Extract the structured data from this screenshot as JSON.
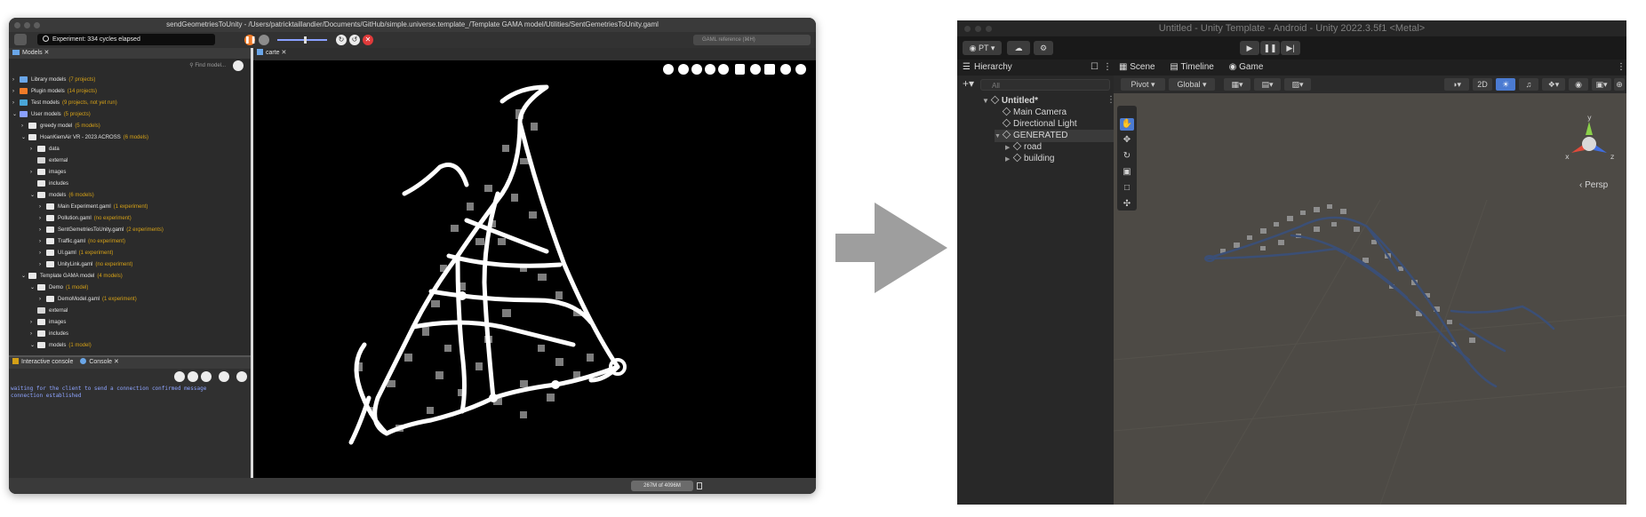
{
  "gama": {
    "title": "sendGeometriesToUnity - /Users/patricktaillandier/Documents/GitHub/simple.universe.template_/Template GAMA model/Utilities/SentGemetriesToUnity.gaml",
    "experiment_label": "Experiment: 334 cycles elapsed",
    "search_placeholder": "GAML reference (⌘H)",
    "models_tab": "Models",
    "find_placeholder": "Find model...",
    "tree": [
      {
        "label": "Library models",
        "note": "(7 projects)",
        "indent": 0,
        "caret": "›",
        "icon": "library"
      },
      {
        "label": "Plugin models",
        "note": "(14 projects)",
        "indent": 0,
        "caret": "›",
        "icon": "plugin"
      },
      {
        "label": "Test models",
        "note": "(9 projects, not yet run)",
        "indent": 0,
        "caret": "›",
        "icon": "test"
      },
      {
        "label": "User models",
        "note": "(5 projects)",
        "indent": 0,
        "caret": "⌄",
        "icon": "user"
      },
      {
        "label": "greedy model",
        "note": "(5 models)",
        "indent": 1,
        "caret": "›",
        "icon": "project"
      },
      {
        "label": "HoanKiemAir VR - 2023 ACROSS",
        "note": "(6 models)",
        "indent": 1,
        "caret": "⌄",
        "icon": "project"
      },
      {
        "label": "data",
        "note": "",
        "indent": 2,
        "caret": "›",
        "icon": "folder"
      },
      {
        "label": "external",
        "note": "",
        "indent": 2,
        "caret": "",
        "icon": "cloud"
      },
      {
        "label": "images",
        "note": "",
        "indent": 2,
        "caret": "›",
        "icon": "folder"
      },
      {
        "label": "includes",
        "note": "",
        "indent": 2,
        "caret": "",
        "icon": "folder"
      },
      {
        "label": "models",
        "note": "(6 models)",
        "indent": 2,
        "caret": "⌄",
        "icon": "folder"
      },
      {
        "label": "Main Experiment.gaml",
        "note": "(1 experiment)",
        "indent": 3,
        "caret": "›",
        "icon": "file"
      },
      {
        "label": "Pollution.gaml",
        "note": "(no experiment)",
        "indent": 3,
        "caret": "›",
        "icon": "file"
      },
      {
        "label": "SentGemetriesToUnity.gaml",
        "note": "(2 experiments)",
        "indent": 3,
        "caret": "›",
        "icon": "file"
      },
      {
        "label": "Traffic.gaml",
        "note": "(no experiment)",
        "indent": 3,
        "caret": "›",
        "icon": "file"
      },
      {
        "label": "UI.gaml",
        "note": "(1 experiment)",
        "indent": 3,
        "caret": "›",
        "icon": "file"
      },
      {
        "label": "UnityLink.gaml",
        "note": "(no experiment)",
        "indent": 3,
        "caret": "›",
        "icon": "file"
      },
      {
        "label": "Template GAMA model",
        "note": "(4 models)",
        "indent": 1,
        "caret": "⌄",
        "icon": "project"
      },
      {
        "label": "Demo",
        "note": "(1 model)",
        "indent": 2,
        "caret": "⌄",
        "icon": "folder"
      },
      {
        "label": "DemoModel.gaml",
        "note": "(1 experiment)",
        "indent": 3,
        "caret": "›",
        "icon": "file"
      },
      {
        "label": "external",
        "note": "",
        "indent": 2,
        "caret": "",
        "icon": "cloud"
      },
      {
        "label": "images",
        "note": "",
        "indent": 2,
        "caret": "›",
        "icon": "folder"
      },
      {
        "label": "includes",
        "note": "",
        "indent": 2,
        "caret": "›",
        "icon": "folder"
      },
      {
        "label": "models",
        "note": "(1 model)",
        "indent": 2,
        "caret": "⌄",
        "icon": "folder"
      }
    ],
    "console_tab_1": "Interactive console",
    "console_tab_2": "Console",
    "console_text": "waiting for the client to send a connection confirmed message\nconnection established",
    "map_tab": "carte",
    "memory": "267M of 4096M"
  },
  "unity": {
    "title": "Untitled - Unity Template - Android - Unity 2022.3.5f1 <Metal>",
    "account": "PT ▾",
    "hierarchy_title": "Hierarchy",
    "search_placeholder": "All",
    "scene_root": "Untitled*",
    "items": [
      {
        "label": "Main Camera",
        "indent": 1,
        "caret": ""
      },
      {
        "label": "Directional Light",
        "indent": 1,
        "caret": ""
      },
      {
        "label": "GENERATED",
        "indent": 1,
        "caret": "▼"
      },
      {
        "label": "road",
        "indent": 2,
        "caret": "▶"
      },
      {
        "label": "building",
        "indent": 2,
        "caret": "▶"
      }
    ],
    "tabs": {
      "scene": "Scene",
      "timeline": "Timeline",
      "game": "Game"
    },
    "pivot": "Pivot",
    "global": "Global",
    "mode_2d": "2D",
    "persp": "‹ Persp",
    "axis_x": "x",
    "axis_y": "y",
    "axis_z": "z",
    "colors": {
      "road": "#3b4f76",
      "building": "#8e8e8e",
      "ground": "#4d4a45"
    }
  }
}
